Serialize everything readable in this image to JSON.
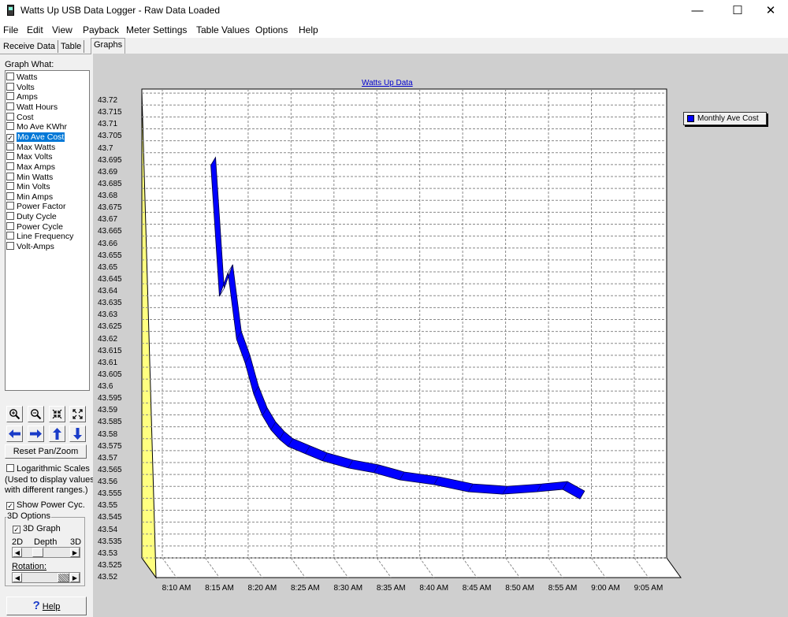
{
  "window": {
    "title": "Watts Up USB Data Logger - Raw Data Loaded",
    "minimize": "—",
    "maximize": "☐",
    "close": "✕"
  },
  "menu": [
    "File",
    "Edit",
    "View",
    "Payback",
    "Meter Settings",
    "Table Values",
    "Options",
    "Help"
  ],
  "tabs": [
    "Receive Data",
    "Table",
    "Graphs"
  ],
  "active_tab": "Graphs",
  "graph_what": {
    "label": "Graph What:",
    "items": [
      {
        "label": "Watts",
        "checked": false
      },
      {
        "label": "Volts",
        "checked": false
      },
      {
        "label": "Amps",
        "checked": false
      },
      {
        "label": "Watt Hours",
        "checked": false
      },
      {
        "label": "Cost",
        "checked": false
      },
      {
        "label": "Mo Ave KWhr",
        "checked": false
      },
      {
        "label": "Mo Ave Cost",
        "checked": true,
        "selected": true
      },
      {
        "label": "Max Watts",
        "checked": false
      },
      {
        "label": "Max Volts",
        "checked": false
      },
      {
        "label": "Max Amps",
        "checked": false
      },
      {
        "label": "Min Watts",
        "checked": false
      },
      {
        "label": "Min Volts",
        "checked": false
      },
      {
        "label": "Min Amps",
        "checked": false
      },
      {
        "label": "Power Factor",
        "checked": false
      },
      {
        "label": "Duty Cycle",
        "checked": false
      },
      {
        "label": "Power Cycle",
        "checked": false
      },
      {
        "label": "Line Frequency",
        "checked": false
      },
      {
        "label": "Volt-Amps",
        "checked": false
      }
    ]
  },
  "controls": {
    "reset_pan_zoom": "Reset Pan/Zoom",
    "log_scales": "Logarithmic Scales",
    "log_note_1": "(Used to display values",
    "log_note_2": "with different ranges.)",
    "show_power_cyc": "Show Power Cyc.",
    "show_power_cyc_checked": true,
    "options_3d": "3D Options",
    "graph_3d": "3D Graph",
    "graph_3d_checked": true,
    "depth_2d": "2D",
    "depth": "Depth",
    "depth_3d": "3D",
    "rotation": "Rotation:",
    "help": "Help",
    "check_mark": "✓"
  },
  "icons": {
    "zoom_in": "zoom-in-icon",
    "zoom_out": "zoom-out-icon",
    "shrink": "shrink-icon",
    "expand": "expand-icon",
    "pan_left": "arrow-left-icon",
    "pan_right": "arrow-right-icon",
    "pan_up": "arrow-up-icon",
    "pan_down": "arrow-down-icon",
    "help": "question-mark-icon"
  },
  "chart_data": {
    "type": "area",
    "title": "Watts Up Data",
    "xlabel": "",
    "ylabel": "",
    "three_d": true,
    "grid": true,
    "legend_position": "top-right",
    "series": [
      {
        "name": "Monthly Ave Cost",
        "color": "#0000ff",
        "x": [
          "8:14",
          "8:15",
          "8:16",
          "8:17",
          "8:18",
          "8:19",
          "8:20",
          "8:21",
          "8:22",
          "8:23",
          "8:25",
          "8:27",
          "8:30",
          "8:33",
          "8:36",
          "8:40",
          "8:44",
          "8:48",
          "8:52",
          "8:55",
          "8:57"
        ],
        "values": [
          43.693,
          43.638,
          43.648,
          43.62,
          43.61,
          43.597,
          43.588,
          43.582,
          43.578,
          43.575,
          43.572,
          43.569,
          43.566,
          43.564,
          43.561,
          43.559,
          43.556,
          43.555,
          43.556,
          43.557,
          43.553
        ]
      }
    ],
    "y_ticks": [
      "43.72",
      "43.715",
      "43.71",
      "43.705",
      "43.7",
      "43.695",
      "43.69",
      "43.685",
      "43.68",
      "43.675",
      "43.67",
      "43.665",
      "43.66",
      "43.655",
      "43.65",
      "43.645",
      "43.64",
      "43.635",
      "43.63",
      "43.625",
      "43.62",
      "43.615",
      "43.61",
      "43.605",
      "43.6",
      "43.595",
      "43.59",
      "43.585",
      "43.58",
      "43.575",
      "43.57",
      "43.565",
      "43.56",
      "43.555",
      "43.55",
      "43.545",
      "43.54",
      "43.535",
      "43.53",
      "43.525",
      "43.52"
    ],
    "x_ticks": [
      "8:10 AM",
      "8:15 AM",
      "8:20 AM",
      "8:25 AM",
      "8:30 AM",
      "8:35 AM",
      "8:40 AM",
      "8:45 AM",
      "8:50 AM",
      "8:55 AM",
      "9:00 AM",
      "9:05 AM"
    ],
    "ylim": [
      43.52,
      43.72
    ],
    "xlim": [
      "8:05",
      "9:05"
    ]
  }
}
